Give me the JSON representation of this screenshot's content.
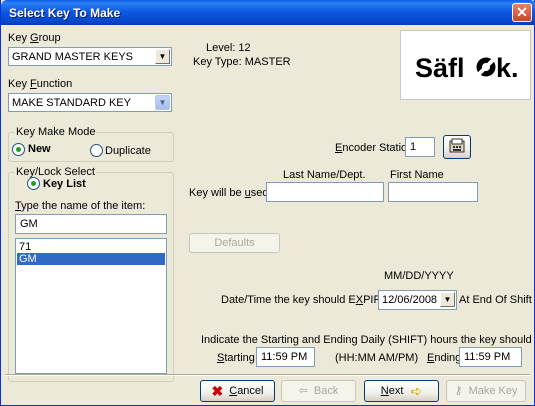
{
  "window": {
    "title": "Select Key To Make"
  },
  "key_group": {
    "label_pre": "Key ",
    "label_u": "G",
    "label_post": "roup",
    "value": "GRAND MASTER KEYS"
  },
  "key_function": {
    "label_pre": "Key ",
    "label_u": "F",
    "label_post": "unction",
    "value": "MAKE STANDARD KEY"
  },
  "info": {
    "level": "Level: 12",
    "key_type": "Key Type: MASTER"
  },
  "logo": {
    "text": "Säflok."
  },
  "key_make_mode": {
    "title": "Key Make Mode",
    "new_label": "New",
    "duplicate_label": "Duplicate"
  },
  "key_lock_select": {
    "title": "Key/Lock Select",
    "key_list_label": "Key List",
    "prompt_pre": "",
    "prompt_u": "T",
    "prompt_post": "ype the name of the item:",
    "search_value": "GM",
    "items": [
      "71",
      "GM"
    ],
    "selected_index": 1
  },
  "encoder": {
    "label_pre": "",
    "label_u": "E",
    "label_post": "ncoder Station:",
    "value": "1"
  },
  "used_by": {
    "label_pre": "Key will be ",
    "label_u": "u",
    "label_post": "sed By:",
    "last_name_header": "Last Name/Dept.",
    "first_name_header": "First Name",
    "last_name_value": "",
    "first_name_value": ""
  },
  "defaults_button": "Defaults",
  "expire": {
    "format_hint": "MM/DD/YYYY",
    "label_pre": "Date/Time the key should E",
    "label_u": "X",
    "label_post": "PIRE:",
    "date_value": "12/06/2008",
    "suffix": "At End Of Shift"
  },
  "shift": {
    "instruction": "Indicate the Starting and Ending Daily (SHIFT) hours the key should work:",
    "starting_label_pre": "",
    "starting_label_u": "S",
    "starting_label_post": "tarting",
    "starting_value": "11:59 PM",
    "format_hint": "(HH:MM AM/PM)",
    "ending_label_pre": "",
    "ending_label_u": "E",
    "ending_label_post": "nding",
    "ending_value": "11:59 PM"
  },
  "buttons": {
    "cancel_u": "C",
    "cancel_post": "ancel",
    "back": "Back",
    "next_u": "N",
    "next_post": "ext",
    "make_key": "Make Key"
  },
  "colors": {
    "title_bar": "#0a56e0",
    "selection": "#316ac5",
    "radio_dot": "#21a121"
  },
  "icons": {
    "close": "close-icon",
    "cancel": "red-x-icon",
    "back": "back-arrow-icon",
    "next": "yellow-arrow-icon",
    "make_key": "key-icon",
    "encoder": "encoder-icon"
  }
}
